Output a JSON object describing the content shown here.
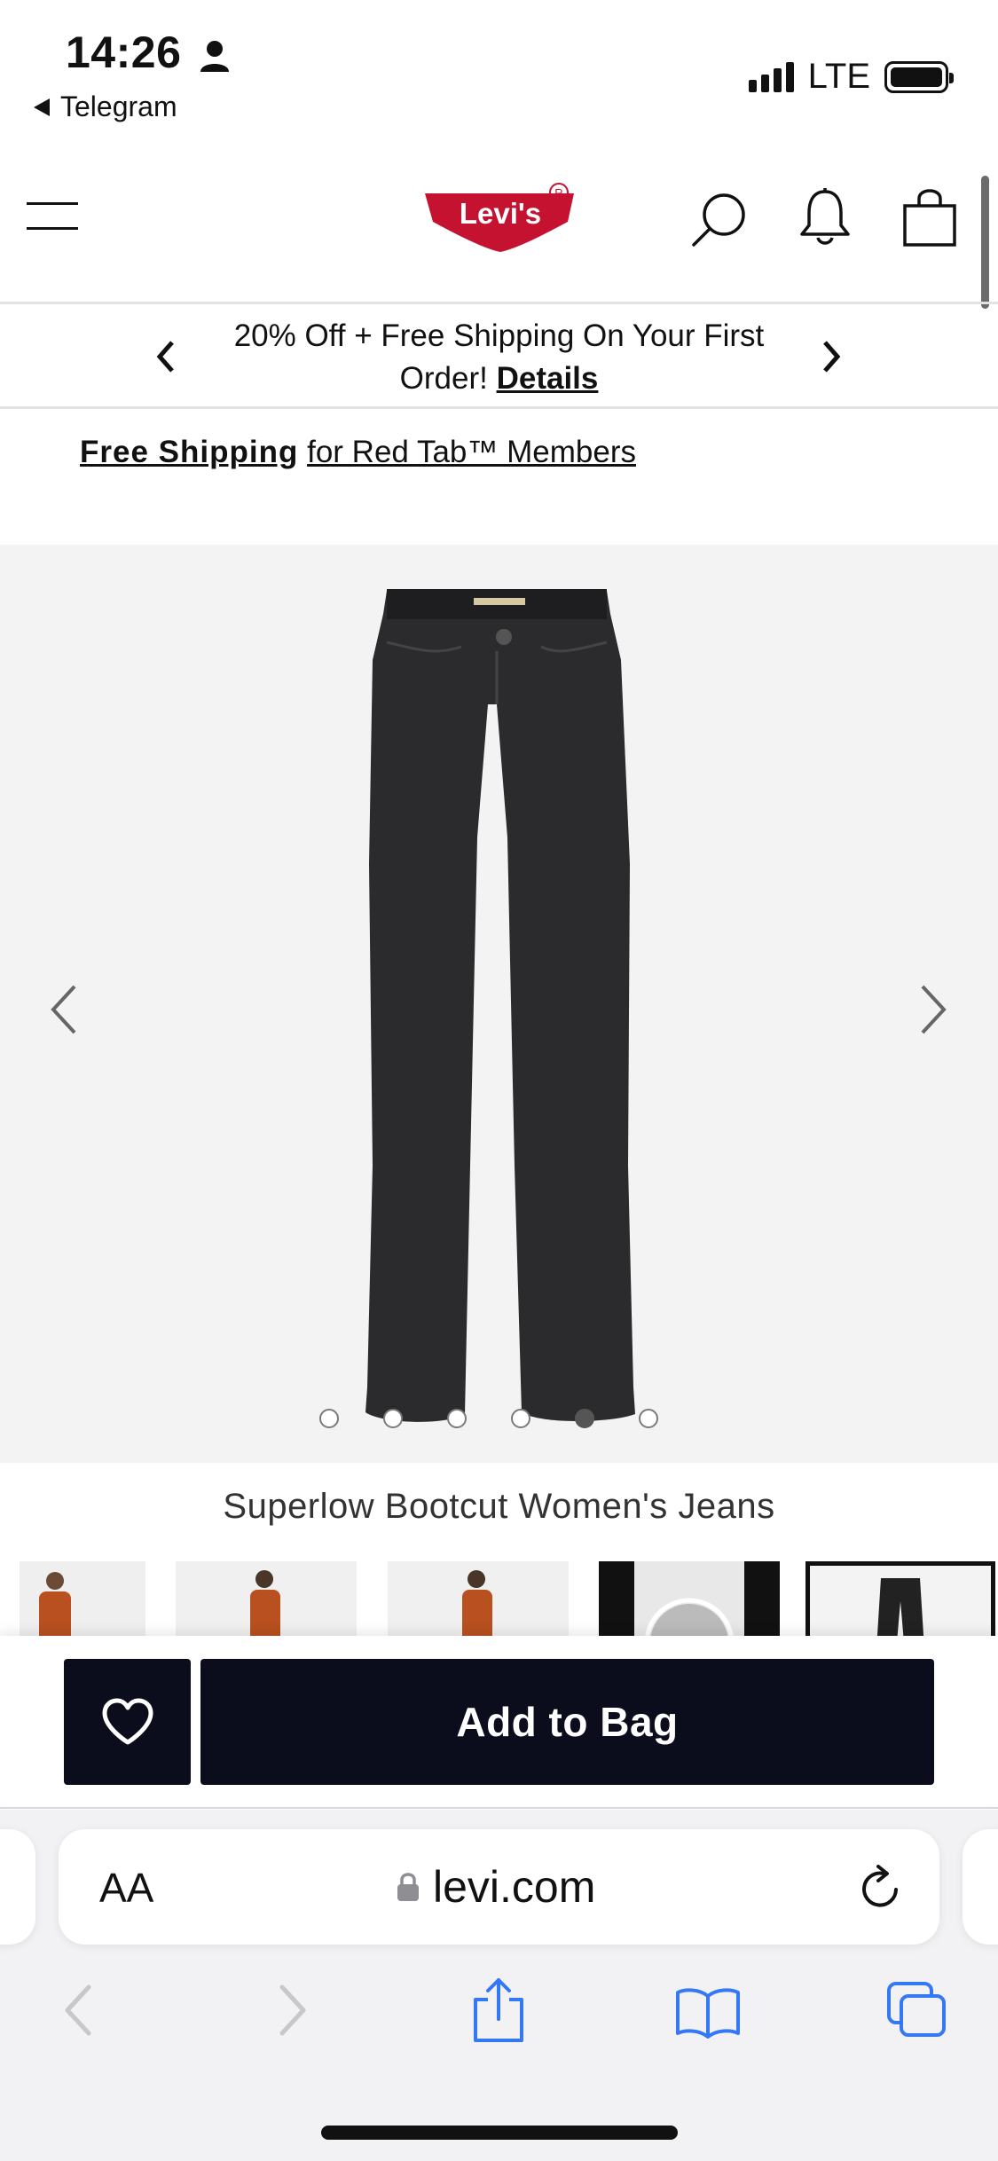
{
  "status_bar": {
    "time": "14:26",
    "back_app": "Telegram",
    "network": "LTE",
    "icons": [
      "person-icon",
      "signal-icon",
      "battery-icon"
    ]
  },
  "header": {
    "brand": "Levi's",
    "icons": [
      "menu-icon",
      "search-icon",
      "bell-icon",
      "bag-icon"
    ]
  },
  "promo": {
    "text": "20% Off + Free Shipping On Your First Order!",
    "link": "Details"
  },
  "free_shipping": {
    "bold": "Free Shipping",
    "rest": "for Red Tab™ Members"
  },
  "product": {
    "title": "Superlow Bootcut Women's Jeans",
    "image_count": 6,
    "active_image": 5
  },
  "actions": {
    "add_to_bag": "Add to Bag",
    "wishlist_icon": "heart-icon"
  },
  "browser": {
    "aa_label": "AA",
    "url": "levi.com",
    "toolbar_icons": [
      "back-icon",
      "forward-icon",
      "share-icon",
      "bookmarks-icon",
      "tabs-icon"
    ]
  },
  "colors": {
    "brand_red": "#c41230",
    "button_dark": "#0c0d1c",
    "safari_blue": "#3478f6"
  }
}
